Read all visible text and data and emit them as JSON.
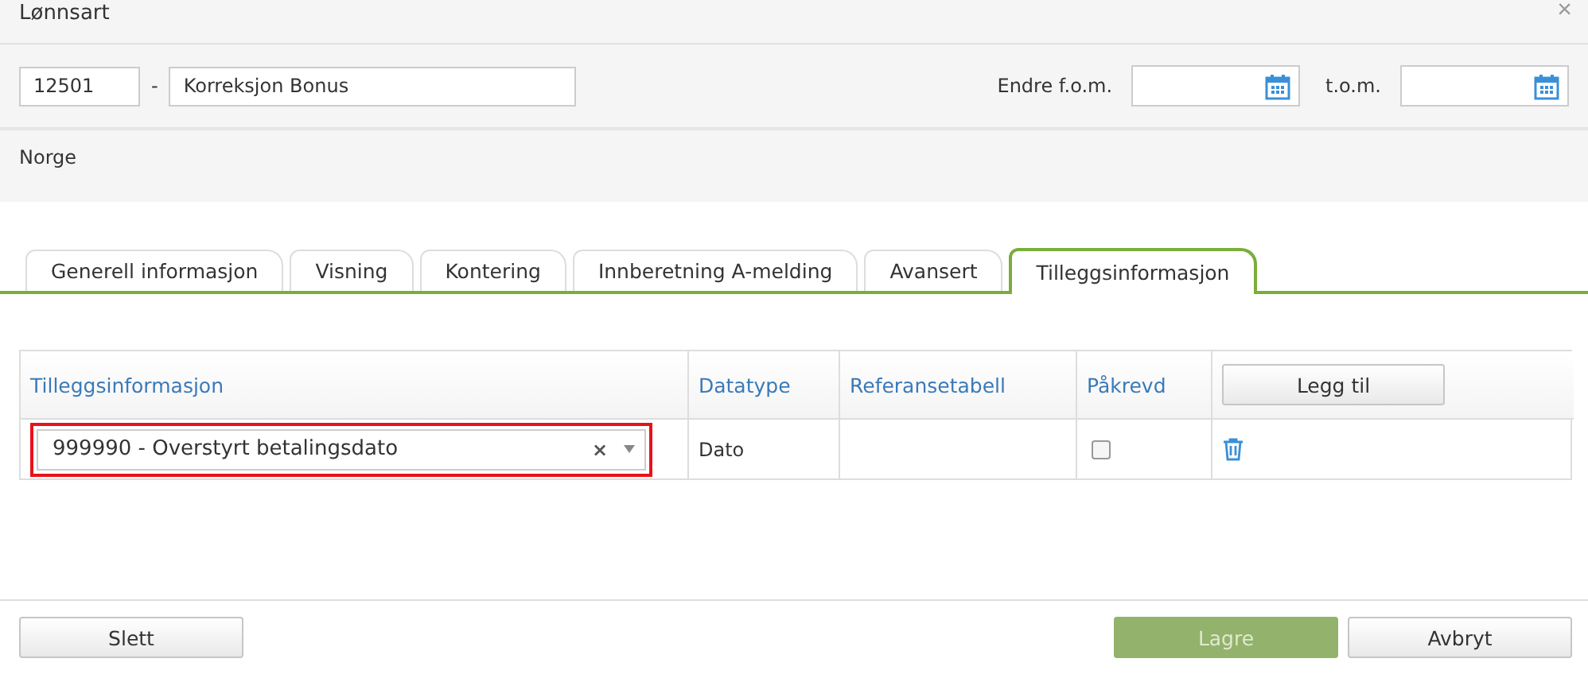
{
  "window": {
    "title": "Lønnsart",
    "close": "×"
  },
  "header": {
    "code": "12501",
    "separator": "-",
    "name": "Korreksjon Bonus",
    "from_label": "Endre f.o.m.",
    "to_label": "t.o.m."
  },
  "country": "Norge",
  "tabs": [
    {
      "label": "Generell informasjon",
      "selected": false
    },
    {
      "label": "Visning",
      "selected": false
    },
    {
      "label": "Kontering",
      "selected": false
    },
    {
      "label": "Innberetning A-melding",
      "selected": false
    },
    {
      "label": "Avansert",
      "selected": false
    },
    {
      "label": "Tilleggsinformasjon",
      "selected": true
    }
  ],
  "table": {
    "columns": [
      "Tilleggsinformasjon",
      "Datatype",
      "Referansetabell",
      "Påkrevd"
    ],
    "add_button": "Legg til",
    "rows": [
      {
        "value": "999990 - Overstyrt betalingsdato",
        "clear": "×",
        "highlighted": true,
        "datatype": "Dato",
        "required": false
      }
    ]
  },
  "footer": {
    "delete_button": "Slett",
    "save_button": {
      "label": "Lagre",
      "disabled": true
    },
    "cancel_button": "Avbryt"
  }
}
